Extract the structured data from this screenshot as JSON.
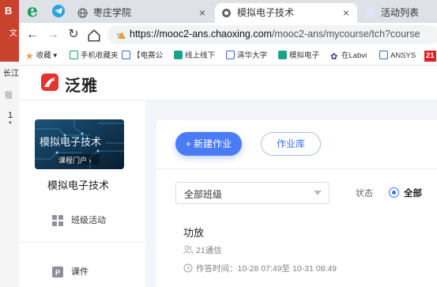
{
  "background_app": {
    "labels": [
      "B",
      "文",
      "长江",
      "版",
      "1",
      "*"
    ]
  },
  "browser": {
    "tabs": [
      {
        "label": "枣庄学院",
        "active": false
      },
      {
        "label": "模拟电子技术",
        "active": true
      },
      {
        "label": "活动列表",
        "active": false
      }
    ],
    "close_glyph": "×",
    "url_host": "https://mooc2-ans.chaoxing.com",
    "url_path": "/mooc2-ans/mycourse/tch?course",
    "bookmarks": [
      "收藏",
      "手机收藏夹",
      "【电赛公",
      "线上线下",
      "清华大学",
      "模拟电子",
      "在Labvi",
      "ANSYS",
      "21"
    ]
  },
  "app": {
    "brand": "泛雅",
    "colors": {
      "primary": "#4a7cf6",
      "brand_red": "#e7332e"
    }
  },
  "sidebar": {
    "cover_title": "模拟电子技术",
    "cover_link": "课程门户 ›",
    "course_name": "模拟电子技术",
    "items": [
      {
        "label": "班级活动",
        "icon": "grid-icon"
      },
      {
        "label": "课件",
        "icon": "ppt-icon"
      }
    ]
  },
  "main": {
    "new_assignment": "+ 新建作业",
    "assignment_library": "作业库",
    "class_select": "全部班级",
    "status_label": "状态",
    "status_option": "全部",
    "task": {
      "title": "功放",
      "class_name": "21通信",
      "time": "作答时间：10-28 07:49至 10-31 08:49"
    }
  }
}
